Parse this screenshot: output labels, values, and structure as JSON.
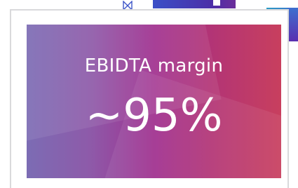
{
  "metric": {
    "label": "EBIDTA margin",
    "value": "~95%"
  },
  "colors": {
    "gradient_start": "#7c6cb4",
    "gradient_mid": "#a0308f",
    "gradient_end": "#c83f5e",
    "card_border": "#d9d9db",
    "accent_blue": "#3d6fcf"
  },
  "icons": {
    "top_icon": "bowtie-icon"
  }
}
